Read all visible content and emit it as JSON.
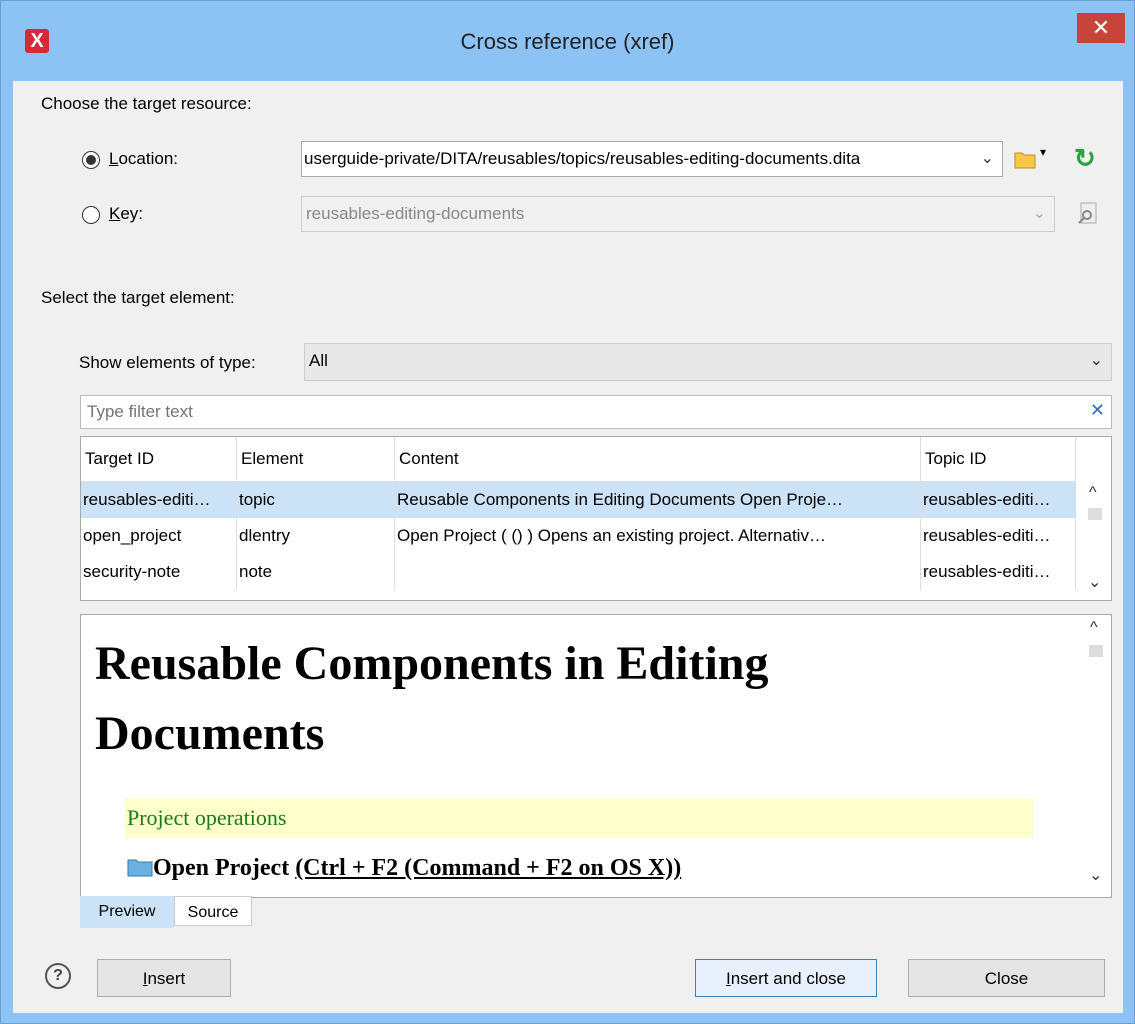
{
  "window": {
    "title": "Cross reference (xref)",
    "close": "✕",
    "app_icon": "X"
  },
  "section1_label": "Choose the target resource:",
  "location": {
    "label": "Location:",
    "value": "userguide-private/DITA/reusables/topics/reusables-editing-documents.dita",
    "selected": true
  },
  "key": {
    "label": "Key:",
    "value": "reusables-editing-documents",
    "selected": false
  },
  "section2_label": "Select the target element:",
  "show_type": {
    "label": "Show elements of type:",
    "value": "All"
  },
  "filter": {
    "placeholder": "Type filter text",
    "clear": "✕"
  },
  "table": {
    "columns": [
      "Target ID",
      "Element",
      "Content",
      "Topic ID"
    ],
    "rows": [
      {
        "target_id": "reusables-editi…",
        "element": "topic",
        "content": "Reusable Components in Editing Documents Open Proje…",
        "topic_id": "reusables-editi…",
        "selected": true
      },
      {
        "target_id": "open_project",
        "element": "dlentry",
        "content": "Open Project ( () ) Opens an existing project. Alternativ…",
        "topic_id": "reusables-editi…",
        "selected": false
      },
      {
        "target_id": "security-note",
        "element": "note",
        "content": "",
        "topic_id": "reusables-editi…",
        "selected": false
      }
    ]
  },
  "preview": {
    "heading_line1": "Reusable Components in Editing",
    "heading_line2": "Documents",
    "section_title": "Project operations",
    "item_title": "Open Project",
    "item_shortcut": "(Ctrl + F2 (Command + F2 on OS X))"
  },
  "tabs": {
    "preview": "Preview",
    "source": "Source"
  },
  "buttons": {
    "help": "?",
    "insert": "Insert",
    "insert_close": "Insert and close",
    "close": "Close"
  },
  "colors": {
    "titlebar": "#8cc3f4",
    "selection": "#cce3f7",
    "close": "#c7443b",
    "section_bg": "#ffffcc"
  }
}
